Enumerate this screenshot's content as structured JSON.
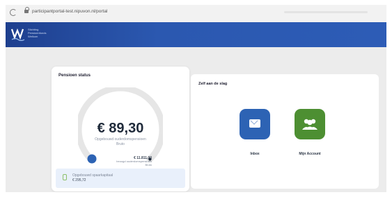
{
  "browser": {
    "url": "participantportal-test.nipuvon.nl/portal"
  },
  "header": {
    "logo_text": "Stichting\nPensioenfonds\nWelkom"
  },
  "pension_status": {
    "title": "Pensioen status",
    "amount": "€ 89,30",
    "amount_label_line1": "Opgebouwd ouderdomspensioen",
    "amount_label_line2": "Bruto",
    "progress_fraction": 0.01,
    "target_amount": "€ 11.811,00",
    "target_label_line1": "beoogd ouderdomspensioen",
    "target_label_line2": "Bruto",
    "savings_label": "Opgebouwd spaarkapitaal",
    "savings_value": "€ 295,72"
  },
  "actions": {
    "title": "Zelf aan de slag",
    "items": [
      {
        "label": "Inbox",
        "icon": "envelope-icon",
        "color": "#2d63b4"
      },
      {
        "label": "Mijn Account",
        "icon": "people-icon",
        "color": "#4d8f32"
      }
    ]
  },
  "colors": {
    "header_blue": "#2b58b0",
    "gauge_track": "#e6e6e6",
    "gauge_indicator": "#2d63b4"
  }
}
